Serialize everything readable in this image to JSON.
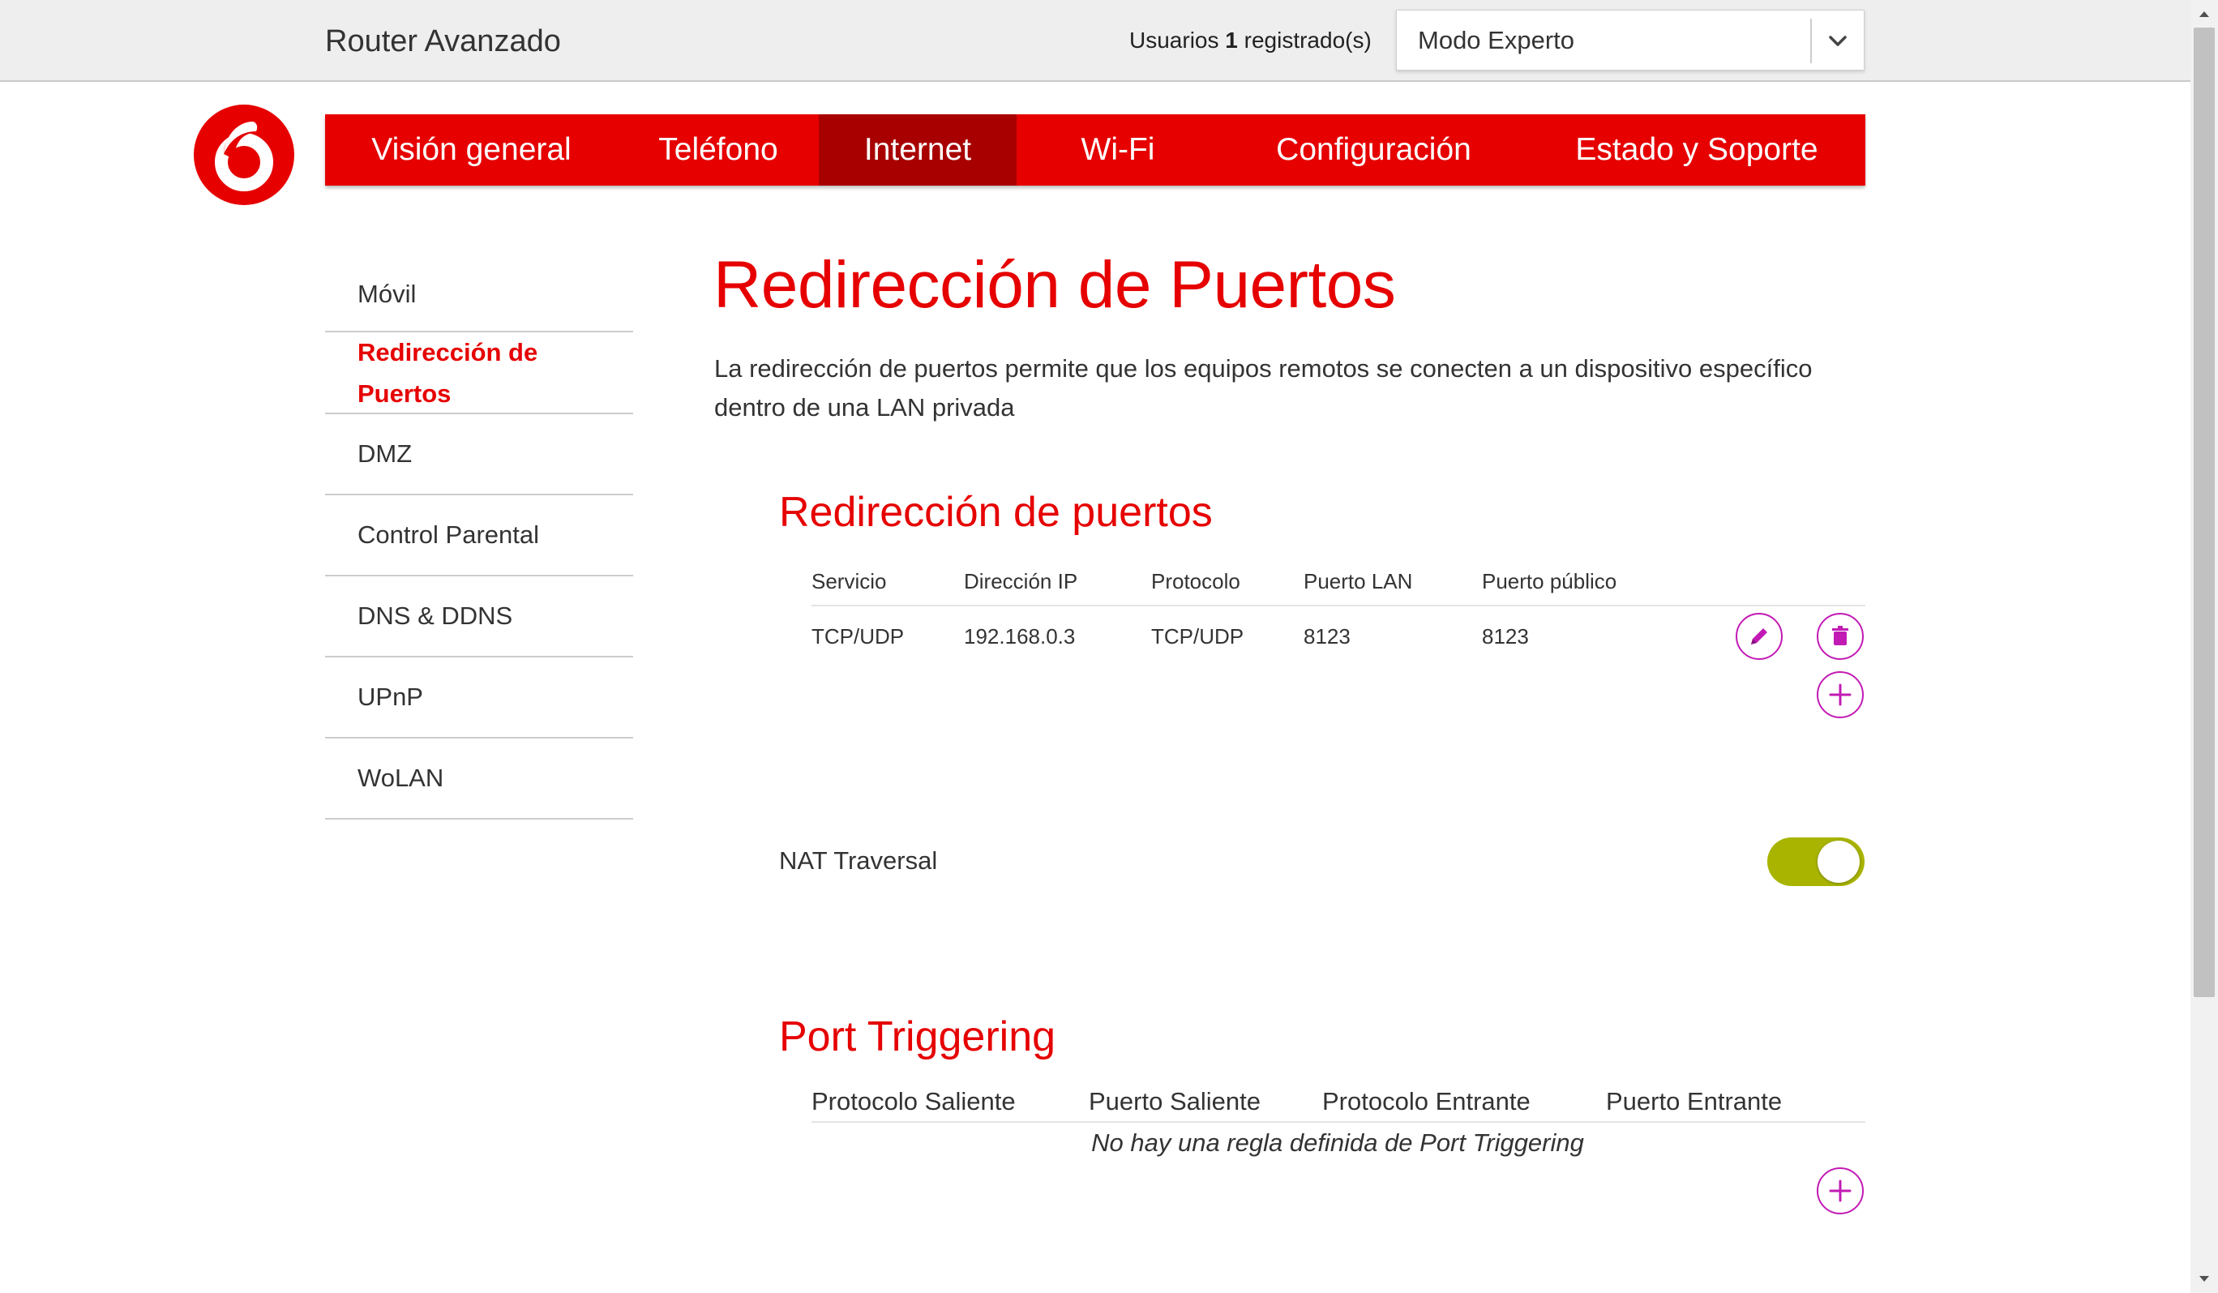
{
  "header": {
    "app_title": "Router Avanzado",
    "users_prefix": "Usuarios",
    "users_count": "1",
    "users_suffix": "registrado(s)",
    "mode_value": "Modo Experto"
  },
  "nav": {
    "tabs": [
      {
        "label": "Visión general"
      },
      {
        "label": "Teléfono"
      },
      {
        "label": "Internet",
        "active": true
      },
      {
        "label": "Wi-Fi"
      },
      {
        "label": "Configuración"
      },
      {
        "label": "Estado y Soporte"
      }
    ]
  },
  "sidebar": {
    "items": [
      {
        "label": "Móvil"
      },
      {
        "label": "Redirección de Puertos",
        "active": true
      },
      {
        "label": "DMZ"
      },
      {
        "label": "Control Parental"
      },
      {
        "label": "DNS & DDNS"
      },
      {
        "label": "UPnP"
      },
      {
        "label": "WoLAN"
      }
    ]
  },
  "main": {
    "title": "Redirección de Puertos",
    "description": "La redirección de puertos permite que los equipos remotos se conecten a un dispositivo específico dentro de una LAN privada"
  },
  "port_forwarding": {
    "title": "Redirección de puertos",
    "columns": [
      "Servicio",
      "Dirección IP",
      "Protocolo",
      "Puerto LAN",
      "Puerto público"
    ],
    "rows": [
      [
        "TCP/UDP",
        "192.168.0.3",
        "TCP/UDP",
        "8123",
        "8123"
      ]
    ]
  },
  "nat": {
    "label": "NAT Traversal",
    "enabled": true
  },
  "port_triggering": {
    "title": "Port Triggering",
    "columns": [
      "Protocolo Saliente",
      "Puerto Saliente",
      "Protocolo Entrante",
      "Puerto Entrante"
    ],
    "empty_message": "No hay una regla definida de Port Triggering"
  },
  "colors": {
    "brand_red": "#e60000",
    "nav_active": "#a80000",
    "action_magenta": "#c21bb4",
    "toggle_on": "#a8b400"
  },
  "icons": [
    "vodafone-logo-icon",
    "chevron-down-icon",
    "edit-icon",
    "delete-icon",
    "add-icon"
  ]
}
